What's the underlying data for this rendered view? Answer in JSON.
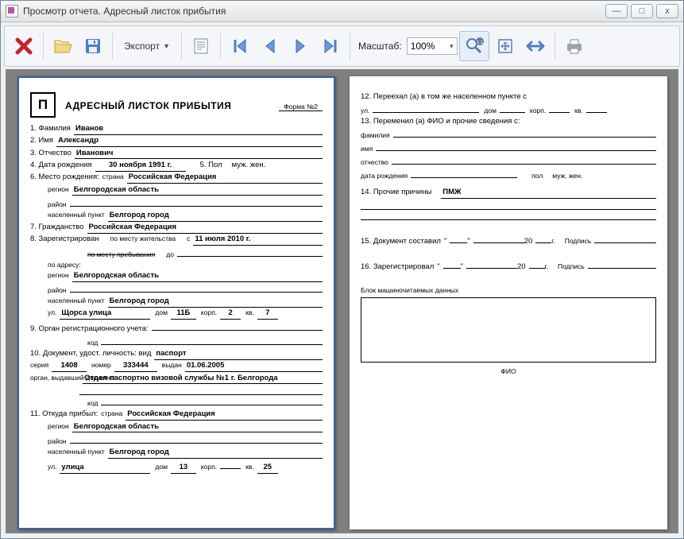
{
  "window": {
    "title": "Просмотр отчета. Адресный листок прибытия"
  },
  "toolbar": {
    "export_label": "Экспорт",
    "zoom_label": "Масштаб:",
    "zoom_value": "100%"
  },
  "form": {
    "formno": "Форма №2",
    "pglyph": "П",
    "title": "АДРЕСНЫЙ ЛИСТОК ПРИБЫТИЯ",
    "l1": "1. Фамилия",
    "surname": "Иванов",
    "l2": "2. Имя",
    "name": "Александр",
    "l3": "3. Отчество",
    "patronymic": "Иванович",
    "l4": "4. Дата рождения",
    "dob": "30 ноября 1991 г.",
    "l5": "5. Пол",
    "sex": "муж.   жен.",
    "l6": "6. Место рождения:",
    "sub_country": "страна",
    "birth_country": "Российская Федерация",
    "sub_region": "регион",
    "birth_region": "Белгородская область",
    "sub_district": "район",
    "birth_district": "",
    "sub_city": "населенный пункт",
    "birth_city": "Белгород город",
    "l7": "7. Гражданство",
    "citizenship": "Российская Федерация",
    "l8": "8. Зарегистрирован",
    "by_residence": "по месту жительства",
    "since_lbl": "с",
    "reg_date": "11 июля 2010 г.",
    "by_stay": "по месту пребывания",
    "until_lbl": "до",
    "until_date": "",
    "addr_lbl": "по адресу:",
    "addr_region": "Белгородская область",
    "addr_district": "",
    "addr_city": "Белгород город",
    "street_lbl": "ул.",
    "street": "Щорса улица",
    "house_lbl": "дом",
    "house": "11Б",
    "korp_lbl": "корп.",
    "korp": "2",
    "flat_lbl": "кв.",
    "flat": "7",
    "l9": "9. Орган регистрационного учета:",
    "reg_body": "",
    "code_lbl": "код",
    "reg_code": "",
    "l10": "10. Документ, удост. личность: вид",
    "doc_type": "паспорт",
    "series_lbl": "серия",
    "series": "1408",
    "number_lbl": "номер",
    "number": "333444",
    "issued_lbl": "выдан",
    "issued": "01.06.2005",
    "issuer_lbl": "орган, выдавший документ",
    "issuer": "Отдел паспортно визовой службы №1 г. Белгорода",
    "issuer_code": "",
    "l11": "11. Откуда прибыл:",
    "from_country": "Российская Федерация",
    "from_region": "Белгородская область",
    "from_district": "",
    "from_city": "Белгород город",
    "from_street": "улица",
    "from_house": "13",
    "from_korp": "",
    "from_flat": "25",
    "l12": "12. Переехал (а) в том же населенном пункте с",
    "p12_street": "",
    "p12_house": "",
    "p12_korp": "",
    "p12_flat": "",
    "l13": "13. Переменил (а) ФИО и прочие сведения с:",
    "p13_surname_lbl": "фамилия",
    "p13_surname": "",
    "p13_name_lbl": "имя",
    "p13_name": "",
    "p13_patr_lbl": "отчество",
    "p13_patr": "",
    "p13_dob_lbl": "дата рождения",
    "p13_dob": "",
    "p13_sex_lbl": "пол",
    "p13_sex": "муж.   жен.",
    "l14": "14. Прочие причины",
    "reason": "ПМЖ",
    "l15": "15. Документ составил",
    "y15": "20",
    "ylbl": "г.",
    "sign_lbl": "Подпись",
    "l16": "16. Зарегистрировал",
    "y16": "20",
    "block_lbl": "Блок машиночитаемых данных",
    "fio_lbl": "ФИО"
  }
}
